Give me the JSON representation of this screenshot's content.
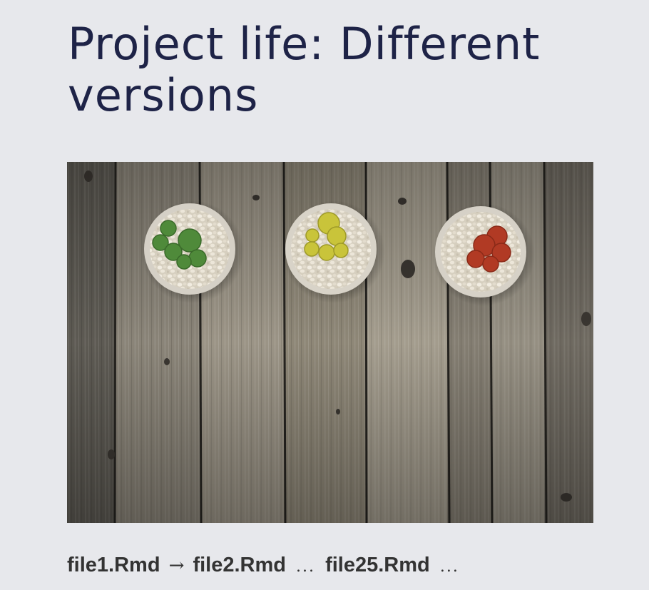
{
  "slide": {
    "title": "Project life: Different versions",
    "image": {
      "subject": "three potted cacti (green, yellow, red) in white pebble-filled pots on weathered wooden planks",
      "colors": {
        "wood_dark": "#3a3833",
        "wood_mid": "#7d776c",
        "wood_light": "#b4ad9f",
        "cactus_green": "#4f8a3a",
        "cactus_yellow": "#c9c43a",
        "cactus_red": "#b13a24",
        "pebbles": "#e4dfd2"
      }
    },
    "caption": {
      "file1": "file1.Rmd",
      "arrow": "→",
      "file2": "file2.Rmd",
      "ellipsis1": "...",
      "file25": "file25.Rmd",
      "ellipsis2": "..."
    }
  },
  "colors": {
    "background": "#e7e8ec",
    "title": "#1e2347",
    "caption": "#333333"
  }
}
